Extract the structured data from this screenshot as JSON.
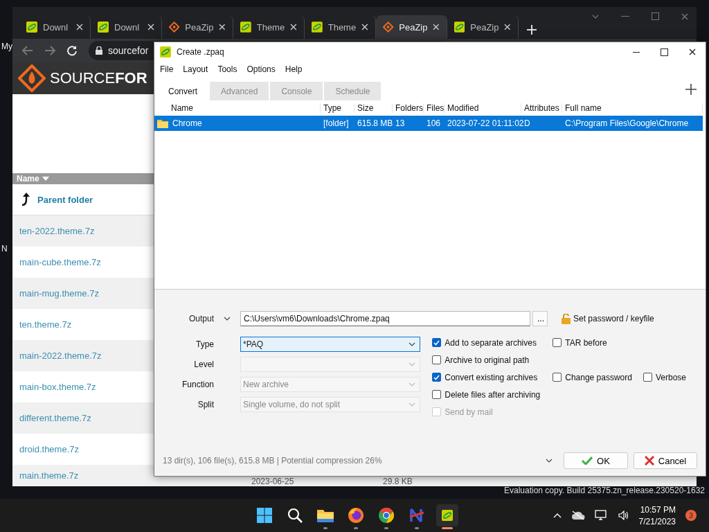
{
  "desktop": {
    "icon_labels": [
      "My",
      "N"
    ],
    "build_text": "Evaluation copy. Build 25375.zn_release.230520-1632"
  },
  "browser": {
    "tabs": [
      {
        "label": "Downl",
        "kind": "peapod",
        "selected": false
      },
      {
        "label": "Downl",
        "kind": "peapod",
        "selected": false
      },
      {
        "label": "PeaZip",
        "kind": "diamond",
        "selected": false
      },
      {
        "label": "Theme",
        "kind": "peapod",
        "selected": false
      },
      {
        "label": "Theme",
        "kind": "peapod",
        "selected": false
      },
      {
        "label": "PeaZip",
        "kind": "diamond",
        "selected": true
      },
      {
        "label": "PeaZip",
        "kind": "peapod",
        "selected": false
      }
    ],
    "address": "sourcefor",
    "site_logo": "SOURCE**FOR**",
    "list_header": "Name",
    "parent_folder": "Parent folder",
    "files": [
      "ten-2022.theme.7z",
      "main-cube.theme.7z",
      "main-mug.theme.7z",
      "ten.theme.7z",
      "main-2022.theme.7z",
      "main-box.theme.7z",
      "different.theme.7z",
      "droid.theme.7z",
      "main.theme.7z"
    ],
    "last_row": {
      "date": "2023-06-25",
      "size": "29.8 KB"
    }
  },
  "dialog": {
    "title": "Create .zpaq",
    "menu": [
      "File",
      "Layout",
      "Tools",
      "Options",
      "Help"
    ],
    "tabs": [
      {
        "label": "Convert",
        "selected": true
      },
      {
        "label": "Advanced",
        "selected": false
      },
      {
        "label": "Console",
        "selected": false
      },
      {
        "label": "Schedule",
        "selected": false
      }
    ],
    "columns": [
      "Name",
      "Type",
      "Size",
      "Folders",
      "Files",
      "Modified",
      "Attributes",
      "Full name"
    ],
    "rows": [
      {
        "selected": true,
        "cells": [
          "Chrome",
          "[folder]",
          "615.8 MB",
          "13",
          "106",
          "2023-07-22 01:11:02",
          "D",
          "C:\\Program Files\\Google\\Chrome"
        ]
      }
    ],
    "output": {
      "label": "Output",
      "value": "C:\\Users\\vm6\\Downloads\\Chrome.zpaq",
      "browse": "...",
      "password": "Set password / keyfile"
    },
    "fields": [
      {
        "label": "Type",
        "value": "*PAQ",
        "disabled": false,
        "focused": true
      },
      {
        "label": "Level",
        "disabled": true,
        "focused": false
      },
      {
        "label": "Function",
        "value": "New archive",
        "disabled": true,
        "focused": false
      },
      {
        "label": "Split",
        "value": "Single volume, do not split",
        "disabled": true,
        "focused": false
      }
    ],
    "option_rows": [
      {
        "options": [
          {
            "label": "Add to separate archives",
            "checked": true,
            "disabled": false
          },
          {
            "label": "TAR before",
            "checked": false,
            "disabled": false
          }
        ]
      },
      {
        "options": [
          {
            "label": "Archive to original path",
            "checked": false,
            "disabled": false
          }
        ]
      },
      {
        "options": [
          {
            "label": "Convert existing archives",
            "checked": true,
            "disabled": false
          },
          {
            "label": "Change password",
            "checked": false,
            "disabled": false
          },
          {
            "label": "Verbose",
            "checked": false,
            "disabled": false
          }
        ]
      },
      {
        "options": [
          {
            "label": "Delete files after archiving",
            "checked": false,
            "disabled": false
          }
        ]
      },
      {
        "options": [
          {
            "label": "Send by mail",
            "checked": false,
            "disabled": true
          }
        ]
      }
    ],
    "status": "13 dir(s), 106 file(s), 615.8 MB | Potential compression 26%",
    "ok": "OK",
    "cancel": "Cancel"
  },
  "taskbar": {
    "apps": [
      {
        "kind": "start",
        "selected": false
      },
      {
        "kind": "search",
        "selected": false
      },
      {
        "kind": "folder",
        "selected": false
      },
      {
        "kind": "firefox",
        "selected": false
      },
      {
        "kind": "chrome",
        "selected": false
      },
      {
        "kind": "notepad",
        "selected": false
      },
      {
        "kind": "peazip",
        "selected": true
      }
    ],
    "time": "10:57 PM",
    "date": "7/21/2023",
    "badge": "3"
  }
}
